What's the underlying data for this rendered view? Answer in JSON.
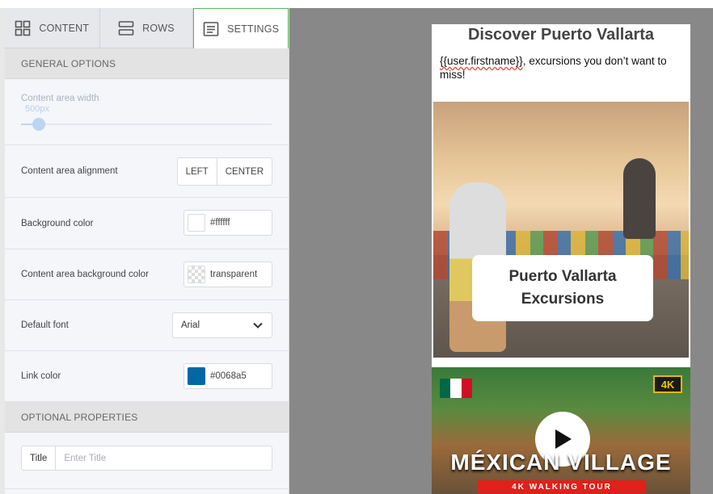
{
  "tabs": [
    {
      "label": "CONTENT",
      "icon": "grid-icon"
    },
    {
      "label": "ROWS",
      "icon": "rows-icon"
    },
    {
      "label": "SETTINGS",
      "icon": "settings-doc-icon"
    }
  ],
  "general": {
    "heading": "GENERAL OPTIONS",
    "content_width": {
      "label": "Content area width",
      "value": "500px",
      "fraction": 0.05
    },
    "alignment": {
      "label": "Content area alignment",
      "options": [
        "LEFT",
        "CENTER"
      ]
    },
    "background_color": {
      "label": "Background color",
      "value": "#ffffff"
    },
    "content_bg_color": {
      "label": "Content area background color",
      "value": "transparent"
    },
    "default_font": {
      "label": "Default font",
      "value": "Arial"
    },
    "link_color": {
      "label": "Link color",
      "value": "#0068a5"
    }
  },
  "optional": {
    "heading": "OPTIONAL PROPERTIES",
    "title": {
      "label": "Title",
      "placeholder": "Enter Title"
    }
  },
  "email": {
    "heading": "Discover Puerto Vallarta",
    "intro_var": "{{user.firstname}}",
    "intro_rest": ", excursions you don’t want to miss!",
    "hero_card": [
      "Puerto Vallarta",
      "Excursions"
    ],
    "video_title": "MÉXICAN VILLAGE",
    "video_subtitle": "4K WALKING TOUR",
    "video_badge": "4K"
  },
  "colors": {
    "accent_tab": "#5cb85c",
    "link": "#0068a5",
    "canvas_bg": "#888888"
  }
}
